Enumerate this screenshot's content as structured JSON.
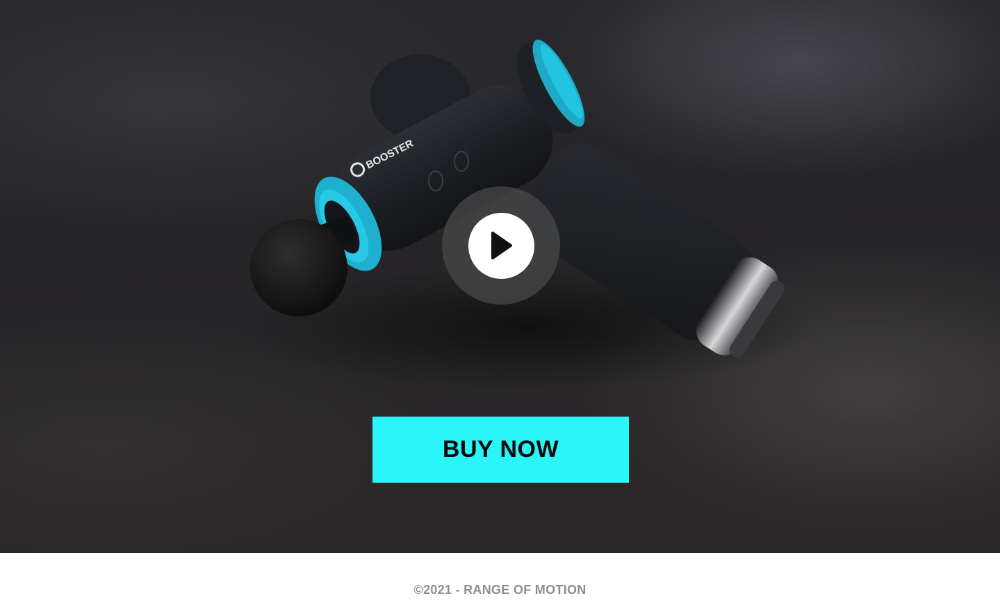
{
  "hero": {
    "product_brand": "BOOSTER",
    "play_icon": "play-icon"
  },
  "cta": {
    "buy_label": "BUY NOW"
  },
  "footer": {
    "copyright": "©2021 - RANGE OF MOTION"
  },
  "colors": {
    "accent": "#2af5f9",
    "footer_text": "#8e8e8e",
    "background": "#262528"
  }
}
